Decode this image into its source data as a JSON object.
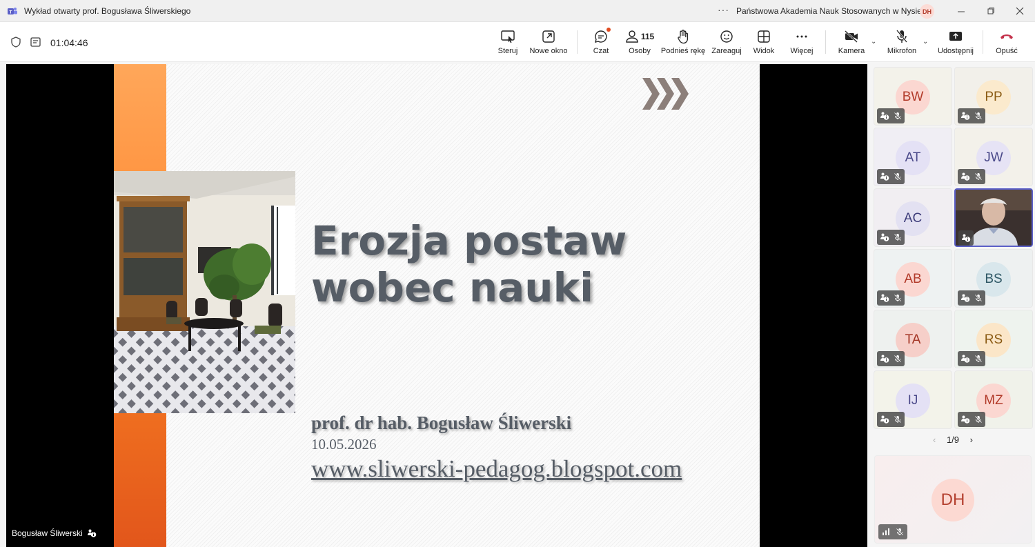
{
  "window": {
    "title": "Wykład otwarty prof. Bogusława Śliwerskiego",
    "organization": "Państwowa Akademia Nauk Stosowanych w Nysie",
    "user_initials": "DH"
  },
  "toolbar": {
    "timer": "01:04:46",
    "buttons": {
      "steruj": "Steruj",
      "nowe_okno": "Nowe okno",
      "czat": "Czat",
      "osoby": "Osoby",
      "osoby_count": "115",
      "podnies": "Podnieś rękę",
      "zareaguj": "Zareaguj",
      "widok": "Widok",
      "wiecej": "Więcej",
      "kamera": "Kamera",
      "mikrofon": "Mikrofon",
      "udostepnij": "Udostępnij",
      "opusc": "Opuść"
    }
  },
  "slide": {
    "title_line1": "Erozja postaw",
    "title_line2": "wobec nauki",
    "author": "prof.  dr hab. Bogusław Śliwerski",
    "date": "10.05.2026",
    "url": "www.sliwerski-pedagog.blogspot.com"
  },
  "stage": {
    "speaker_name": "Bogusław Śliwerski"
  },
  "participants": [
    {
      "initials": "BW",
      "bg": "#f3f2ea",
      "avatar_bg": "#fbd7d1",
      "color": "#b23b2a"
    },
    {
      "initials": "PP",
      "bg": "#f2f0ea",
      "avatar_bg": "#fbeacd",
      "color": "#8a5a12"
    },
    {
      "initials": "AT",
      "bg": "#f0eef4",
      "avatar_bg": "#e4e1f5",
      "color": "#4b4a8a"
    },
    {
      "initials": "JW",
      "bg": "#f3f1ea",
      "avatar_bg": "#e6e3f5",
      "color": "#4b4a8a"
    },
    {
      "initials": "AC",
      "bg": "#f1eef2",
      "avatar_bg": "#e3e1f2",
      "color": "#3d3c7a"
    },
    {
      "initials": "",
      "bg": "#3a3030",
      "avatar_bg": "",
      "color": ""
    },
    {
      "initials": "AB",
      "bg": "#eef2f2",
      "avatar_bg": "#fbd7d1",
      "color": "#b23b2a"
    },
    {
      "initials": "BS",
      "bg": "#eef1f1",
      "avatar_bg": "#d9e7ec",
      "color": "#2f5866"
    },
    {
      "initials": "TA",
      "bg": "#eef1ef",
      "avatar_bg": "#f6cfc9",
      "color": "#a33525"
    },
    {
      "initials": "RS",
      "bg": "#eef3ee",
      "avatar_bg": "#fbe6c8",
      "color": "#8a5a12"
    },
    {
      "initials": "IJ",
      "bg": "#f3f3ea",
      "avatar_bg": "#e4e1f5",
      "color": "#4b4a8a"
    },
    {
      "initials": "MZ",
      "bg": "#f0f2ea",
      "avatar_bg": "#fbd7d1",
      "color": "#b23b2a"
    }
  ],
  "pager": {
    "label": "1/9"
  },
  "self_tile": {
    "initials": "DH"
  }
}
